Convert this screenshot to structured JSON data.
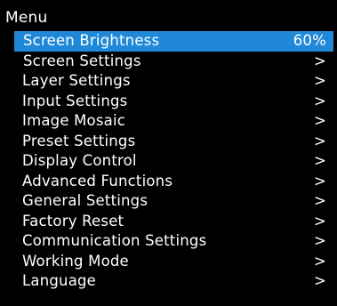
{
  "menu": {
    "title": "Menu",
    "items": [
      {
        "label": "Screen Brightness",
        "value": "60%",
        "selected": true
      },
      {
        "label": "Screen Settings",
        "value": ">"
      },
      {
        "label": "Layer Settings",
        "value": ">"
      },
      {
        "label": "Input Settings",
        "value": ">"
      },
      {
        "label": "Image Mosaic",
        "value": ">"
      },
      {
        "label": "Preset Settings",
        "value": ">"
      },
      {
        "label": "Display Control",
        "value": ">"
      },
      {
        "label": "Advanced Functions",
        "value": ">"
      },
      {
        "label": "General Settings",
        "value": ">"
      },
      {
        "label": "Factory Reset",
        "value": ">"
      },
      {
        "label": "Communication Settings",
        "value": ">"
      },
      {
        "label": "Working Mode",
        "value": ">"
      },
      {
        "label": "Language",
        "value": ">"
      }
    ]
  },
  "colors": {
    "background": "#000000",
    "text": "#ffffff",
    "selection": "#1f88d8"
  }
}
